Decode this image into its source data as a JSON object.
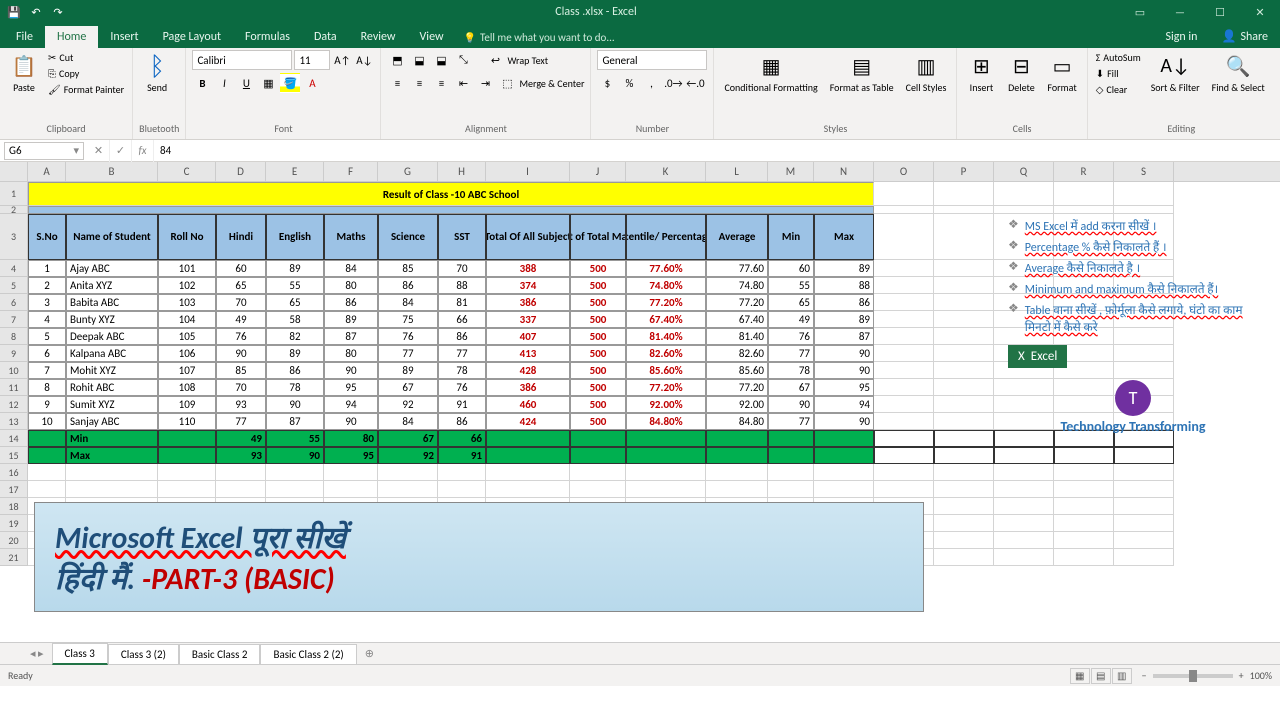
{
  "app": {
    "title": "Class .xlsx - Excel"
  },
  "tabs": {
    "file": "File",
    "home": "Home",
    "insert": "Insert",
    "pagelayout": "Page Layout",
    "formulas": "Formulas",
    "data": "Data",
    "review": "Review",
    "view": "View",
    "tellme": "Tell me what you want to do...",
    "signin": "Sign in",
    "share": "Share"
  },
  "ribbon": {
    "paste": "Paste",
    "cut": "Cut",
    "copy": "Copy",
    "fmtpainter": "Format Painter",
    "clipboard": "Clipboard",
    "bluetooth": "Bluetooth",
    "send": "Send",
    "font": "Calibri",
    "size": "11",
    "fontgrp": "Font",
    "wrap": "Wrap Text",
    "merge": "Merge & Center",
    "alignment": "Alignment",
    "numfmt": "General",
    "number": "Number",
    "cond": "Conditional Formatting",
    "fmttable": "Format as Table",
    "cellstyles": "Cell Styles",
    "styles": "Styles",
    "insertc": "Insert",
    "delete": "Delete",
    "format": "Format",
    "cells": "Cells",
    "autosum": "AutoSum",
    "fill": "Fill",
    "clear": "Clear",
    "sortfilter": "Sort & Filter",
    "findselect": "Find & Select",
    "editing": "Editing"
  },
  "namebox": "G6",
  "formula": "84",
  "cols": [
    "A",
    "B",
    "C",
    "D",
    "E",
    "F",
    "G",
    "H",
    "I",
    "J",
    "K",
    "L",
    "M",
    "N",
    "O",
    "P",
    "Q",
    "R",
    "S"
  ],
  "titleRow": "Result of Class -10 ABC School",
  "headers": [
    "S.No",
    "Name of Student",
    "Roll No",
    "Hindi",
    "English",
    "Maths",
    "Science",
    "SST",
    "Total Of All Subject",
    "Out of Total Marks",
    "Percentile/ Percentage %",
    "Average",
    "Min",
    "Max"
  ],
  "rows": [
    [
      "1",
      "Ajay ABC",
      "101",
      "60",
      "89",
      "84",
      "85",
      "70",
      "388",
      "500",
      "77.60%",
      "77.60",
      "60",
      "89"
    ],
    [
      "2",
      "Anita XYZ",
      "102",
      "65",
      "55",
      "80",
      "86",
      "88",
      "374",
      "500",
      "74.80%",
      "74.80",
      "55",
      "88"
    ],
    [
      "3",
      "Babita ABC",
      "103",
      "70",
      "65",
      "86",
      "84",
      "81",
      "386",
      "500",
      "77.20%",
      "77.20",
      "65",
      "86"
    ],
    [
      "4",
      "Bunty XYZ",
      "104",
      "49",
      "58",
      "89",
      "75",
      "66",
      "337",
      "500",
      "67.40%",
      "67.40",
      "49",
      "89"
    ],
    [
      "5",
      "Deepak ABC",
      "105",
      "76",
      "82",
      "87",
      "76",
      "86",
      "407",
      "500",
      "81.40%",
      "81.40",
      "76",
      "87"
    ],
    [
      "6",
      "Kalpana ABC",
      "106",
      "90",
      "89",
      "80",
      "77",
      "77",
      "413",
      "500",
      "82.60%",
      "82.60",
      "77",
      "90"
    ],
    [
      "7",
      "Mohit XYZ",
      "107",
      "85",
      "86",
      "90",
      "89",
      "78",
      "428",
      "500",
      "85.60%",
      "85.60",
      "78",
      "90"
    ],
    [
      "8",
      "Rohit ABC",
      "108",
      "70",
      "78",
      "95",
      "67",
      "76",
      "386",
      "500",
      "77.20%",
      "77.20",
      "67",
      "95"
    ],
    [
      "9",
      "Sumit XYZ",
      "109",
      "93",
      "90",
      "94",
      "92",
      "91",
      "460",
      "500",
      "92.00%",
      "92.00",
      "90",
      "94"
    ],
    [
      "10",
      "Sanjay ABC",
      "110",
      "77",
      "87",
      "90",
      "84",
      "86",
      "424",
      "500",
      "84.80%",
      "84.80",
      "77",
      "90"
    ]
  ],
  "minRow": [
    "",
    "Min",
    "",
    "49",
    "55",
    "80",
    "67",
    "66",
    "",
    "",
    "",
    "",
    "",
    ""
  ],
  "maxRow": [
    "",
    "Max",
    "",
    "93",
    "90",
    "95",
    "92",
    "91",
    "",
    "",
    "",
    "",
    "",
    ""
  ],
  "annot": {
    "b1": "MS Excel में add करना सीखें ।",
    "b2": "Percentage % कैसे निकालते हैं ।",
    "b3": "Average कैसे निकालते है ।",
    "b4": "Minimum and maximum कैसे निकालते हैं।",
    "b5": "Table वाना सीखें , फ़ोर्मूला कैसे लगाये, घंटो का काम मिनटो में कैसे करे",
    "excel": "Excel",
    "brand": "Technology Transforming"
  },
  "banner": {
    "l1": "Microsoft Excel पूरा सीखें",
    "l2a": "हिंदी मैं.",
    "l2b": " -PART-3 (BASIC)"
  },
  "sheettabs": [
    "Class 3",
    "Class 3 (2)",
    "Basic Class 2",
    "Basic Class 2 (2)"
  ],
  "status": {
    "ready": "Ready",
    "zoom": "100%"
  }
}
